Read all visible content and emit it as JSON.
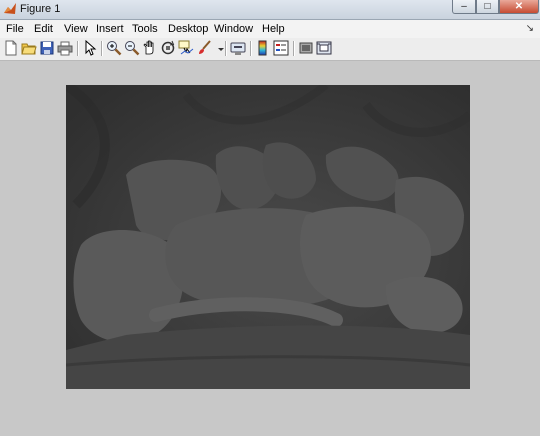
{
  "window": {
    "title": "Figure 1"
  },
  "menu": {
    "items": [
      "File",
      "Edit",
      "View",
      "Insert",
      "Tools",
      "Desktop",
      "Window",
      "Help"
    ]
  },
  "toolbar": {
    "icons": [
      "new-figure-icon",
      "open-file-icon",
      "save-icon",
      "print-icon",
      "edit-plot-icon",
      "zoom-in-icon",
      "zoom-out-icon",
      "pan-icon",
      "rotate-3d-icon",
      "data-cursor-icon",
      "brush-icon",
      "link-plot-icon",
      "colorbar-icon",
      "legend-icon",
      "hide-plot-tools-icon",
      "show-plot-tools-icon"
    ]
  },
  "figure": {
    "content": "grayscale image",
    "image_tone_hex": "#3c3c3c",
    "background_hex": "#c8c8c8"
  }
}
